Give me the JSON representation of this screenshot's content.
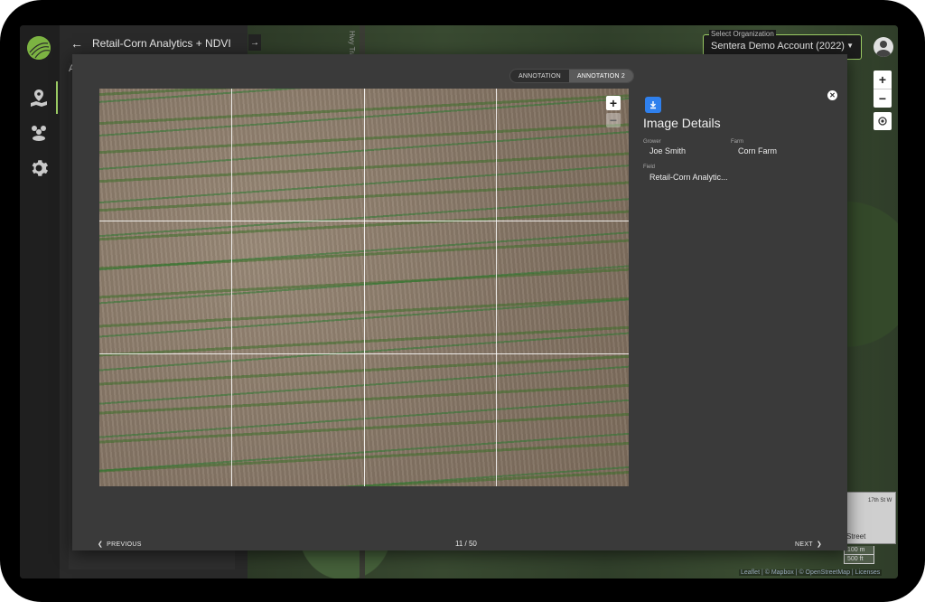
{
  "app": {
    "title": "Retail-Corn Analytics + NDVI",
    "subtitle": "A"
  },
  "org": {
    "label": "Select Organization",
    "value": "Sentera Demo Account (2022)"
  },
  "map": {
    "road_label": "Hwy Trail",
    "minimap_label_1": "17th St W",
    "minimap_label_2": "Street",
    "scale_1": "100 m",
    "scale_2": "500 ft",
    "attribution": "Leaflet | © Mapbox | © OpenStreetMap | Licenses"
  },
  "modal": {
    "tabs": [
      "ANNOTATION",
      "ANNOTATION 2"
    ],
    "selected_tab": "ANNOTATION 2",
    "details_title": "Image Details",
    "grower_label": "Grower",
    "grower_value": "Joe Smith",
    "farm_label": "Farm",
    "farm_value": "Corn Farm",
    "field_label": "Field",
    "field_value": "Retail-Corn Analytic...",
    "previous": "PREVIOUS",
    "next": "NEXT",
    "counter": "11 / 50",
    "grid": {
      "cols": 4,
      "rows": 3
    }
  },
  "colors": {
    "accent": "#9ccc65",
    "download": "#2f80ed",
    "modal_bg": "#3a3a3a"
  },
  "icons": [
    "logo-icon",
    "field-pin-icon",
    "groups-icon",
    "gear-icon",
    "back-arrow-icon",
    "chevron-right-icon",
    "download-icon",
    "close-icon",
    "plus-icon",
    "minus-icon",
    "locate-icon",
    "user-icon"
  ]
}
